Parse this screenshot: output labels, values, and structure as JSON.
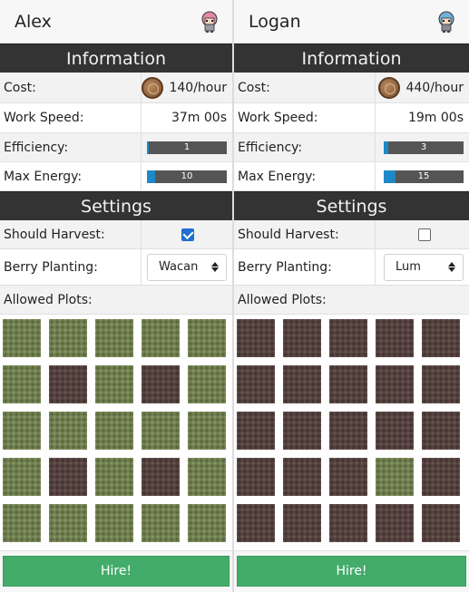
{
  "colors": {
    "header_dark": "#333333",
    "hire_green": "#43ac6a",
    "bar_blue": "#1e88c8",
    "plot_grass": "#6f7e4f",
    "plot_soil": "#54423f"
  },
  "farmers": [
    {
      "name": "Alex",
      "avatar_icon": "pink-haired-trainer-sprite",
      "information_title": "Information",
      "cost_label": "Cost:",
      "cost_value": "140/hour",
      "cost_icon": "farm-point-coin-icon",
      "work_speed_label": "Work Speed:",
      "work_speed_value": "37m 00s",
      "efficiency_label": "Efficiency:",
      "efficiency_value": "1",
      "efficiency_fill_pct": 2,
      "max_energy_label": "Max Energy:",
      "max_energy_value": "10",
      "max_energy_fill_pct": 10,
      "settings_title": "Settings",
      "should_harvest_label": "Should Harvest:",
      "should_harvest_checked": true,
      "berry_planting_label": "Berry Planting:",
      "berry_planting_value": "Wacan",
      "allowed_plots_label": "Allowed Plots:",
      "plots": [
        "g",
        "g",
        "g",
        "g",
        "g",
        "g",
        "s",
        "g",
        "s",
        "g",
        "g",
        "g",
        "g",
        "g",
        "g",
        "g",
        "s",
        "g",
        "s",
        "g",
        "g",
        "g",
        "g",
        "g",
        "g"
      ],
      "hire_label": "Hire!"
    },
    {
      "name": "Logan",
      "avatar_icon": "blue-haired-trainer-sprite",
      "information_title": "Information",
      "cost_label": "Cost:",
      "cost_value": "440/hour",
      "cost_icon": "farm-point-coin-icon",
      "work_speed_label": "Work Speed:",
      "work_speed_value": "19m 00s",
      "efficiency_label": "Efficiency:",
      "efficiency_value": "3",
      "efficiency_fill_pct": 6,
      "max_energy_label": "Max Energy:",
      "max_energy_value": "15",
      "max_energy_fill_pct": 15,
      "settings_title": "Settings",
      "should_harvest_label": "Should Harvest:",
      "should_harvest_checked": false,
      "berry_planting_label": "Berry Planting:",
      "berry_planting_value": "Lum",
      "allowed_plots_label": "Allowed Plots:",
      "plots": [
        "s",
        "s",
        "s",
        "s",
        "s",
        "s",
        "s",
        "s",
        "s",
        "s",
        "s",
        "s",
        "s",
        "s",
        "s",
        "s",
        "s",
        "s",
        "g",
        "s",
        "s",
        "s",
        "s",
        "s",
        "s"
      ],
      "hire_label": "Hire!"
    }
  ]
}
